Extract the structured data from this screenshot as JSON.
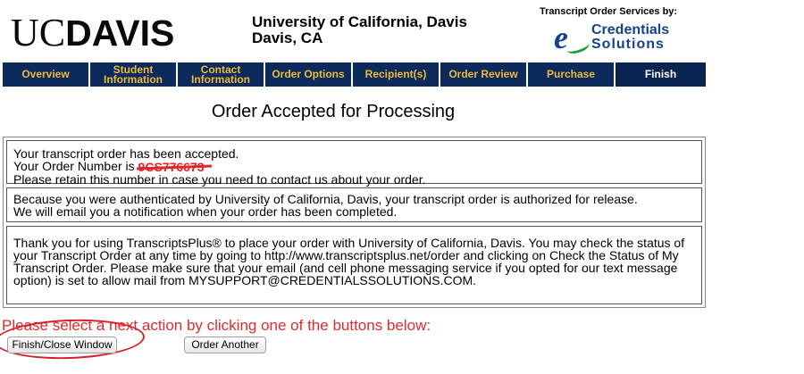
{
  "header": {
    "logo_uc": "UC",
    "logo_davis": "DAVIS",
    "university_line1": "University of California, Davis",
    "university_line2": "Davis, CA",
    "services_by": "Transcript Order Services by:",
    "partner_logo_letter": "e",
    "partner_line1": "Credentials",
    "partner_line2": "Solutions"
  },
  "nav": {
    "tabs": [
      {
        "label": "Overview",
        "active": false
      },
      {
        "label": "Student Information",
        "active": false
      },
      {
        "label": "Contact Information",
        "active": false
      },
      {
        "label": "Order Options",
        "active": false
      },
      {
        "label": "Recipient(s)",
        "active": false
      },
      {
        "label": "Order Review",
        "active": false
      },
      {
        "label": "Purchase",
        "active": false
      },
      {
        "label": "Finish",
        "active": true
      }
    ],
    "tab_color": "#0c2a5b",
    "tab_text_color": "#f0b93a",
    "active_text_color": "#ffffff"
  },
  "page_title": "Order Accepted for Processing",
  "box1": {
    "line1": "Your transcript order has been accepted.",
    "line2_prefix": "Your Order Number is ",
    "order_number": "9CS776673",
    "line3": "Please retain this number in case you need to contact us about your order."
  },
  "box2": {
    "line1": "Because you were authenticated by University of California, Davis, your transcript order is authorized for release.",
    "line2": "We will email you a notification when your order has been completed."
  },
  "box3": {
    "text": "Thank you for using TranscriptsPlus® to place your order with University of California, Davis. You may check the status of your Transcript Order at any time by going to http://www.transcriptsplus.net/order and clicking on Check the Status of My Transcript Order. Please make sure that your email (and cell phone messaging service if you opted for our text message option) is set to allow mail from MYSUPPORT@CREDENTIALSSOLUTIONS.COM."
  },
  "next_action": {
    "prompt": "Please select a next action by clicking one of the buttons below:",
    "finish_button": "Finish/Close Window",
    "order_another_button": "Order Another"
  },
  "colors": {
    "prompt_red": "#e32b2b",
    "annotation_red": "#d61f2a",
    "partner_blue": "#15428b",
    "partner_green": "#1a9a3a"
  }
}
